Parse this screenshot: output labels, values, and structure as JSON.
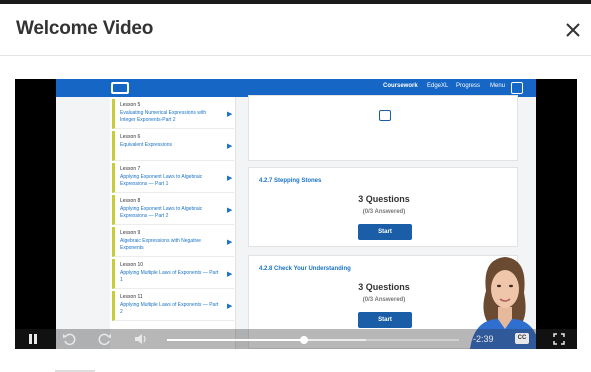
{
  "modal": {
    "title": "Welcome Video",
    "close_label": "×"
  },
  "video_frame": {
    "nav": {
      "items": [
        "Coursework",
        "EdgeXL",
        "Progress",
        "Menu"
      ]
    },
    "lessons": [
      {
        "num": "Lesson 5",
        "title": "Evaluating Numerical Expressions with Integer Exponents-Part 2"
      },
      {
        "num": "Lesson 6",
        "title": "Equivalent Expressions"
      },
      {
        "num": "Lesson 7",
        "title": "Applying Exponent Laws to Algebraic Expressions — Part 1"
      },
      {
        "num": "Lesson 8",
        "title": "Applying Exponent Laws to Algebraic Expressions — Part 2"
      },
      {
        "num": "Lesson 9",
        "title": "Algebraic Expressions with Negative Exponents"
      },
      {
        "num": "Lesson 10",
        "title": "Applying Multiple Laws of Exponents — Part 1"
      },
      {
        "num": "Lesson 11",
        "title": "Applying Multiple Laws of Exponents — Part 2"
      }
    ],
    "cards": [
      {
        "title": "4.2.7 Stepping Stones",
        "questions": "3 Questions",
        "answered": "(0/3 Answered)",
        "button": "Start"
      },
      {
        "title": "4.2.8 Check Your Understanding",
        "questions": "3 Questions",
        "answered": "(0/3 Answered)",
        "button": "Start"
      }
    ]
  },
  "player": {
    "time_remaining": "-2:39",
    "cc_label": "CC",
    "progress_fraction": 0.47,
    "buffered_fraction": 0.68,
    "icons": {
      "pause": "pause-icon",
      "rewind": "rewind-icon",
      "forward": "forward-icon",
      "volume": "volume-icon",
      "captions": "captions-icon",
      "fullscreen": "fullscreen-icon"
    }
  },
  "colors": {
    "nav_blue": "#1666c5",
    "lesson_accent": "#c8cc3a",
    "start_button": "#1a5ea8"
  }
}
